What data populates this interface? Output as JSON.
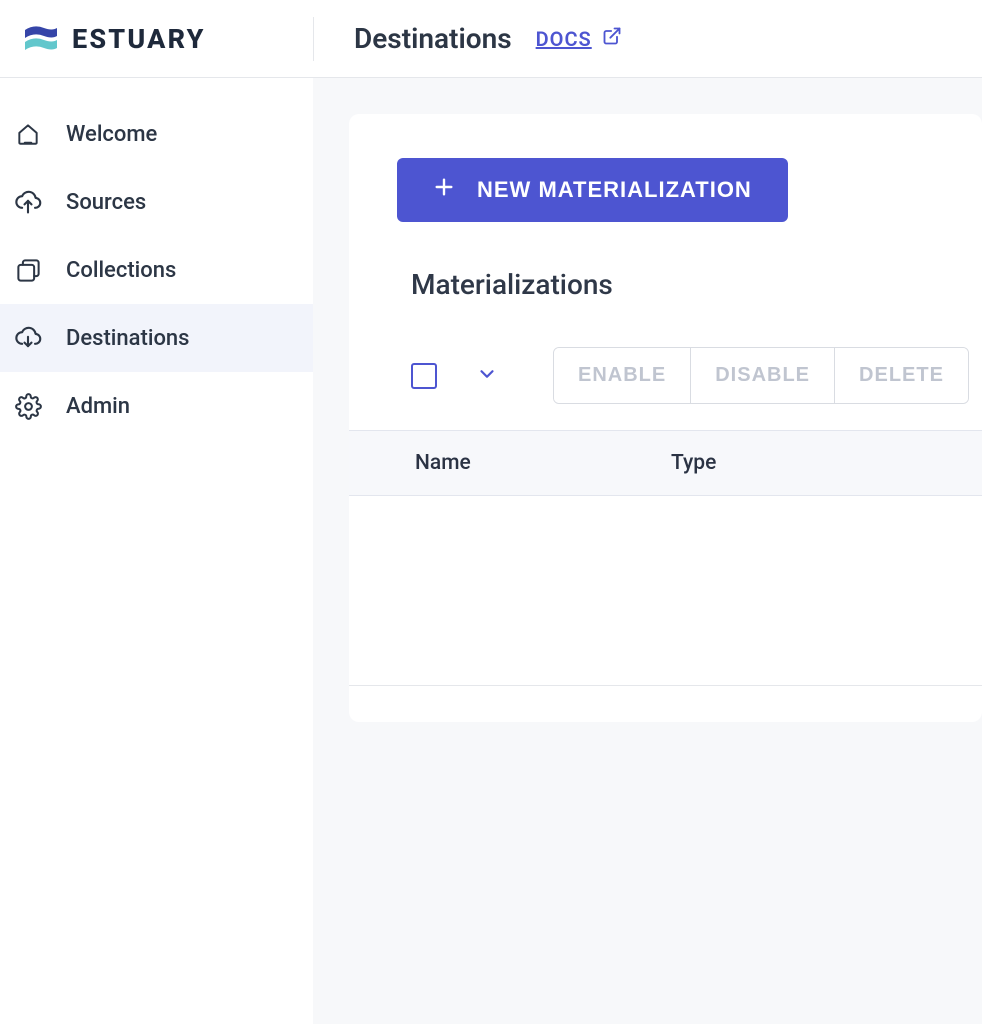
{
  "brand": {
    "name": "ESTUARY"
  },
  "header": {
    "title": "Destinations",
    "docs_label": "DOCS"
  },
  "sidebar": {
    "items": [
      {
        "label": "Welcome"
      },
      {
        "label": "Sources"
      },
      {
        "label": "Collections"
      },
      {
        "label": "Destinations"
      },
      {
        "label": "Admin"
      }
    ]
  },
  "main": {
    "new_button": "NEW MATERIALIZATION",
    "section_title": "Materializations",
    "buttons": {
      "enable": "ENABLE",
      "disable": "DISABLE",
      "delete": "DELETE"
    },
    "columns": {
      "name": "Name",
      "type": "Type"
    }
  }
}
